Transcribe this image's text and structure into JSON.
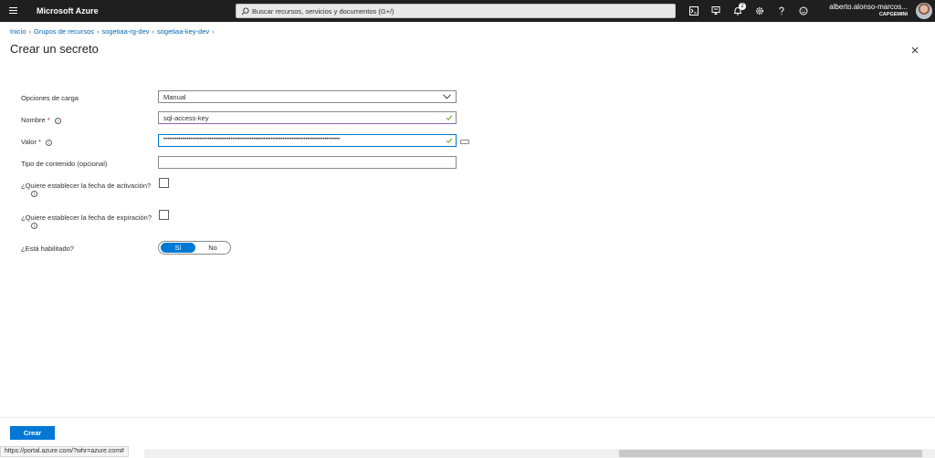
{
  "topbar": {
    "brand": "Microsoft Azure",
    "search_placeholder": "Buscar recursos, servicios y documentos (G+/)",
    "notification_count": "2",
    "user_name": "alberto.alonso-marcos...",
    "user_org": "CAPGEMINI"
  },
  "breadcrumb": [
    "Inicio",
    "Grupos de recursos",
    "sogetiaa-rg-dev",
    "sogetiaa-key-dev"
  ],
  "page": {
    "title": "Crear un secreto"
  },
  "form": {
    "upload_options": {
      "label": "Opciones de carga",
      "value": "Manual"
    },
    "name": {
      "label": "Nombre",
      "value": "sql-access-key"
    },
    "value": {
      "label": "Valor",
      "value": "••••••••••••••••••••••••••••••••••••••••••••••••••••••••••••••••••••••••••••••••••••••••••••"
    },
    "content_type": {
      "label": "Tipo de contenido (opcional)",
      "value": ""
    },
    "activation": {
      "label": "¿Quiere establecer la fecha de activación?"
    },
    "expiration": {
      "label": "¿Quiere establecer la fecha de expiración?"
    },
    "enabled": {
      "label": "¿Está habilitado?",
      "yes": "Sí",
      "no": "No",
      "selected": "Sí"
    },
    "required_mark": "*"
  },
  "footer": {
    "create_label": "Crear"
  },
  "status": {
    "url": "https://portal.azure.com/?whr=azure.com#"
  },
  "colors": {
    "accent": "#0078d4",
    "topbar": "#1f1f1f",
    "link": "#0067b8"
  }
}
